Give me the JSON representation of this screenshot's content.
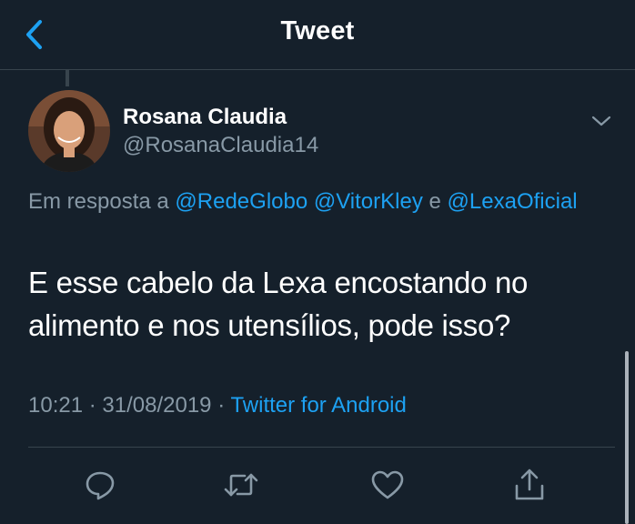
{
  "header": {
    "title": "Tweet",
    "back_icon": "chevron-left-icon"
  },
  "author": {
    "name": "Rosana Claudia",
    "handle": "@RosanaClaudia14"
  },
  "reply_context": {
    "prefix": "Em resposta a",
    "mentions": [
      "@RedeGlobo",
      "@VitorKley",
      "@LexaOficial"
    ],
    "conjunction": "e"
  },
  "tweet": {
    "text": "E esse cabelo da Lexa encostando no alimento e nos utensílios, pode isso?",
    "time": "10:21",
    "date": "31/08/2019",
    "separator": "·",
    "source": "Twitter for Android"
  },
  "actions": {
    "icons": [
      "reply-icon",
      "retweet-icon",
      "like-icon",
      "share-icon"
    ]
  },
  "colors": {
    "background": "#15202b",
    "accent": "#1da1f2",
    "secondary_text": "#8899a6",
    "border": "#38444d"
  }
}
